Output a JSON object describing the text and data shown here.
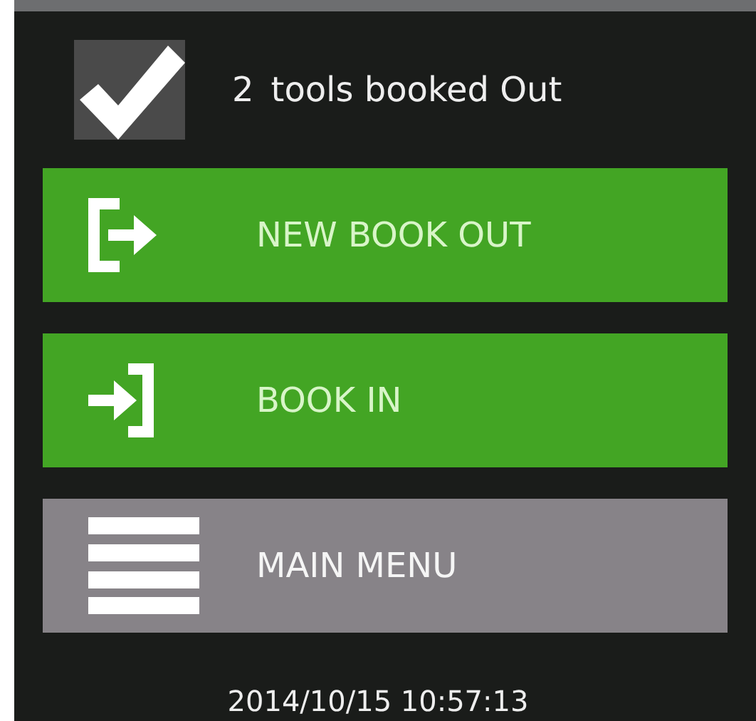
{
  "status": {
    "checked": true,
    "count": "2",
    "label": "tools booked Out"
  },
  "buttons": [
    {
      "kind": "book-out",
      "label": "NEW BOOK OUT"
    },
    {
      "kind": "book-in",
      "label": "BOOK IN"
    },
    {
      "kind": "menu",
      "label": "MAIN MENU"
    }
  ],
  "datetime": "2014/10/15 10:57:13"
}
